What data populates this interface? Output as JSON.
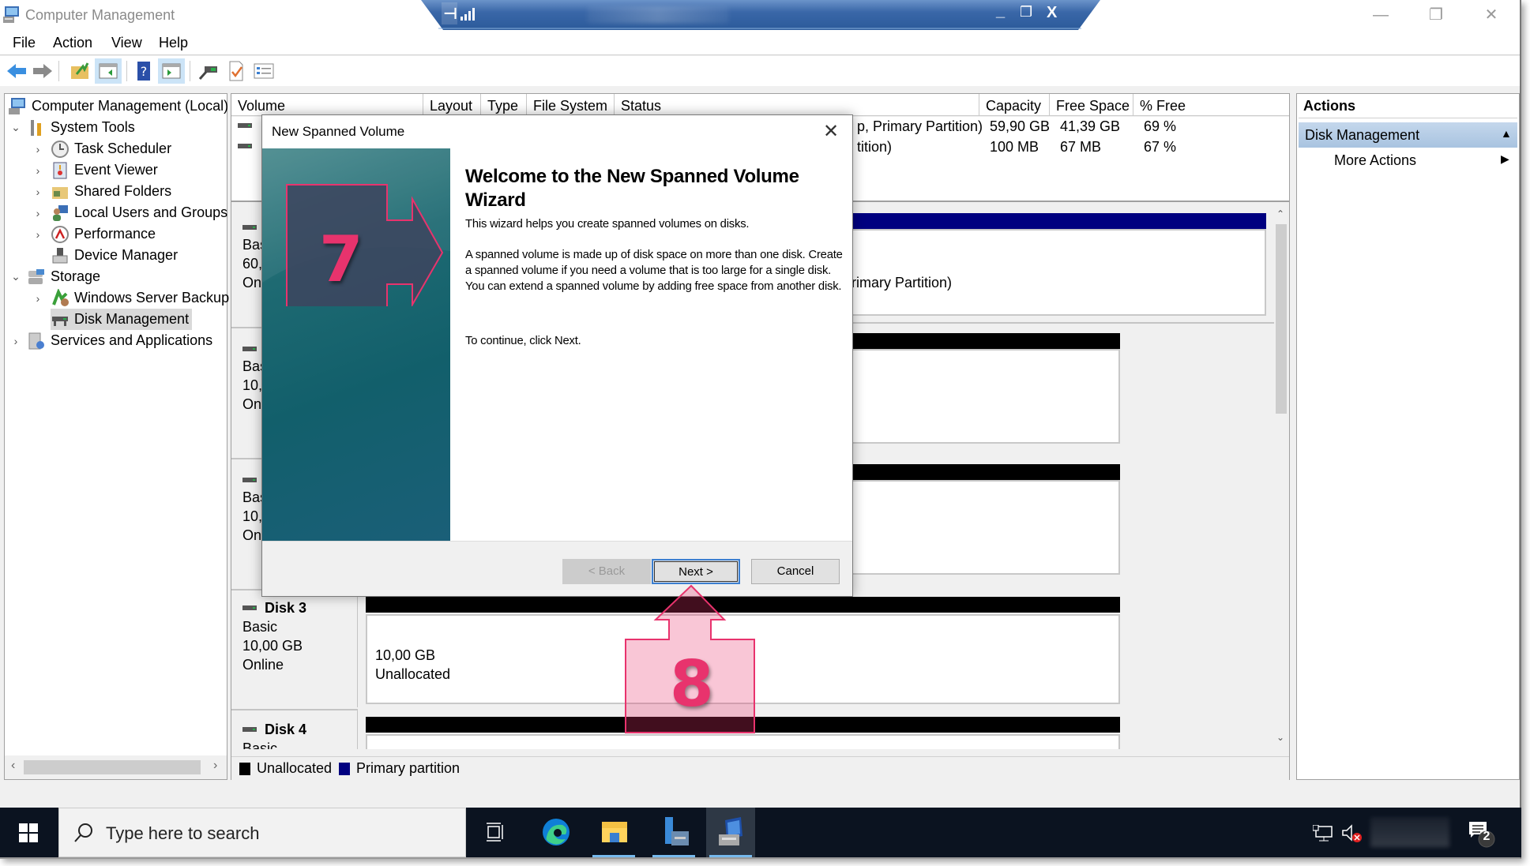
{
  "window": {
    "title": "Computer Management",
    "controls": {
      "minimize": "—",
      "restore": "❐",
      "close": "✕"
    }
  },
  "remote_bar": {
    "pin_icon": "pin-icon",
    "signal_icon": "signal-icon",
    "minimize": "_",
    "restore": "❐",
    "close": "X"
  },
  "menu": [
    "File",
    "Action",
    "View",
    "Help"
  ],
  "toolbar": [
    "back-icon",
    "forward-icon",
    "up-folder-icon",
    "show-hide-tree-icon",
    "help-icon",
    "show-hide-action-pane-icon",
    "connect-icon",
    "properties-check-icon",
    "list-icon"
  ],
  "tree": {
    "root": "Computer Management (Local)",
    "items": [
      {
        "label": "System Tools",
        "level": 1,
        "expanded": true
      },
      {
        "label": "Task Scheduler",
        "level": 2,
        "expandable": true
      },
      {
        "label": "Event Viewer",
        "level": 2,
        "expandable": true
      },
      {
        "label": "Shared Folders",
        "level": 2,
        "expandable": true
      },
      {
        "label": "Local Users and Groups",
        "level": 2,
        "expandable": true
      },
      {
        "label": "Performance",
        "level": 2,
        "expandable": true
      },
      {
        "label": "Device Manager",
        "level": 2,
        "expandable": false
      },
      {
        "label": "Storage",
        "level": 1,
        "expanded": true
      },
      {
        "label": "Windows Server Backup",
        "level": 2,
        "expandable": true
      },
      {
        "label": "Disk Management",
        "level": 2,
        "expandable": false,
        "selected": true
      },
      {
        "label": "Services and Applications",
        "level": 1,
        "expandable": true
      }
    ]
  },
  "volume_table": {
    "columns": [
      "Volume",
      "Layout",
      "Type",
      "File System",
      "Status",
      "Capacity",
      "Free Space",
      "% Free"
    ],
    "rows": [
      {
        "status_fragment": "p, Primary Partition)",
        "capacity": "59,90 GB",
        "free": "41,39 GB",
        "pct": "69 %"
      },
      {
        "status_fragment": "tition)",
        "capacity": "100 MB",
        "free": "67 MB",
        "pct": "67 %"
      }
    ]
  },
  "disks": [
    {
      "name_fragment": "",
      "type_fragment": "Bas",
      "size_fragment": "60,",
      "status_fragment": "On",
      "partition_text": "mp, Primary Partition)"
    },
    {
      "name_fragment": "",
      "type_fragment": "Bas",
      "size_fragment": "10,",
      "status_fragment": "On"
    },
    {
      "name_fragment": "",
      "type_fragment": "Bas",
      "size_fragment": "10,",
      "status_fragment": "On"
    },
    {
      "name": "Disk 3",
      "type": "Basic",
      "size": "10,00 GB",
      "status": "Online",
      "partition_size": "10,00 GB",
      "partition_state": "Unallocated"
    },
    {
      "name": "Disk 4",
      "type": "Basic"
    }
  ],
  "legend": [
    {
      "label": "Unallocated",
      "color": "#000000"
    },
    {
      "label": "Primary partition",
      "color": "#000080"
    }
  ],
  "actions": {
    "title": "Actions",
    "section": "Disk Management",
    "items": [
      "More Actions"
    ]
  },
  "dialog": {
    "title": "New Spanned Volume",
    "heading": "Welcome to the New Spanned Volume Wizard",
    "para1": "This wizard helps you create spanned volumes on disks.",
    "para2": "A spanned volume is made up of disk space on more than one disk. Create a spanned volume if you need a volume that is too large for a single disk. You can extend a spanned volume by adding free space from another disk.",
    "para3": "To continue, click Next.",
    "buttons": {
      "back": "< Back",
      "next": "Next >",
      "cancel": "Cancel"
    },
    "back_enabled": false
  },
  "annotations": [
    {
      "number": "7",
      "shape": "arrow-right",
      "color": "#e8336d"
    },
    {
      "number": "8",
      "shape": "arrow-up",
      "color": "#e8336d"
    }
  ],
  "taskbar": {
    "search_placeholder": "Type here to search",
    "apps": [
      "task-view-icon",
      "edge-icon",
      "file-explorer-icon",
      "server-manager-icon",
      "computer-management-icon"
    ],
    "notification_count": "2"
  }
}
